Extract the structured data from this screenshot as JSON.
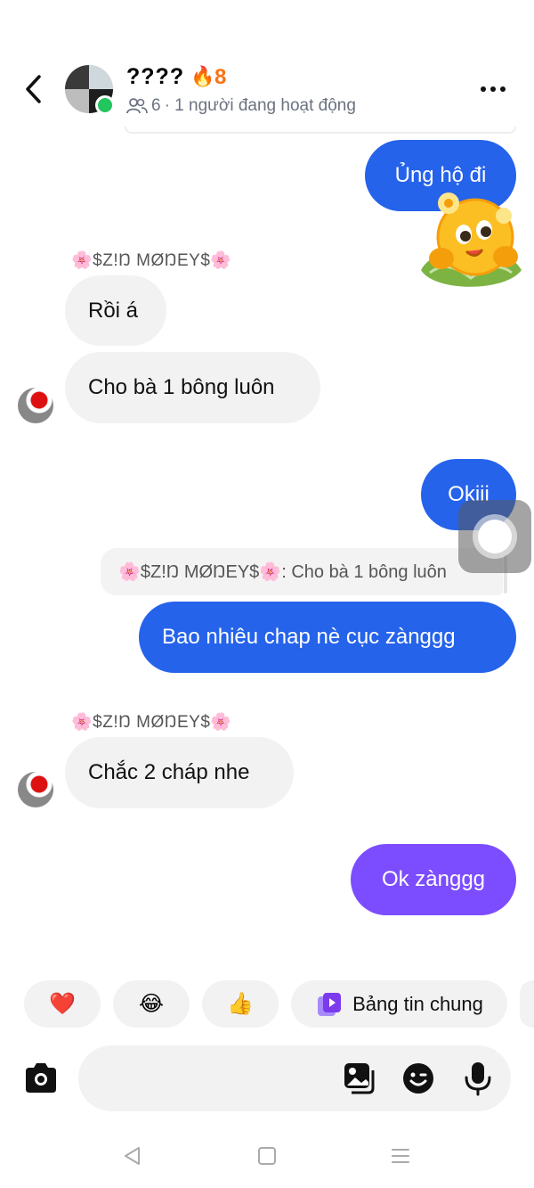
{
  "header": {
    "title": "????",
    "streak_icon": "fire-icon",
    "streak_count": "8",
    "member_count": "6",
    "status_text": "· 1 người đang hoạt động",
    "online_color": "#22c55e"
  },
  "messages": {
    "out_1": "Ủng hộ đi",
    "sender_1": "🌸$Z!Ŋ MØŊEY$🌸",
    "in_1": "Rồi á",
    "in_2": "Cho bà 1 bông luôn",
    "out_2": "Okiii",
    "reply_quote": "🌸$Z!Ŋ MØŊEY$🌸: Cho bà 1 bông luôn",
    "out_3": "Bao nhiêu chap nè cục zànggg",
    "sender_2": "🌸$Z!Ŋ MØŊEY$🌸",
    "in_3": "Chắc 2 cháp nhe",
    "out_4": "Ok zànggg"
  },
  "quick_replies": {
    "heart": "❤️",
    "laugh": "😂",
    "thumbs": "👍",
    "feed_label": "Bảng tin chung"
  },
  "composer": {
    "placeholder": ""
  },
  "colors": {
    "outgoing_blue": "#2563eb",
    "outgoing_purple": "#7c4dff",
    "incoming_gray": "#f2f2f2",
    "streak_orange": "#f97316"
  }
}
